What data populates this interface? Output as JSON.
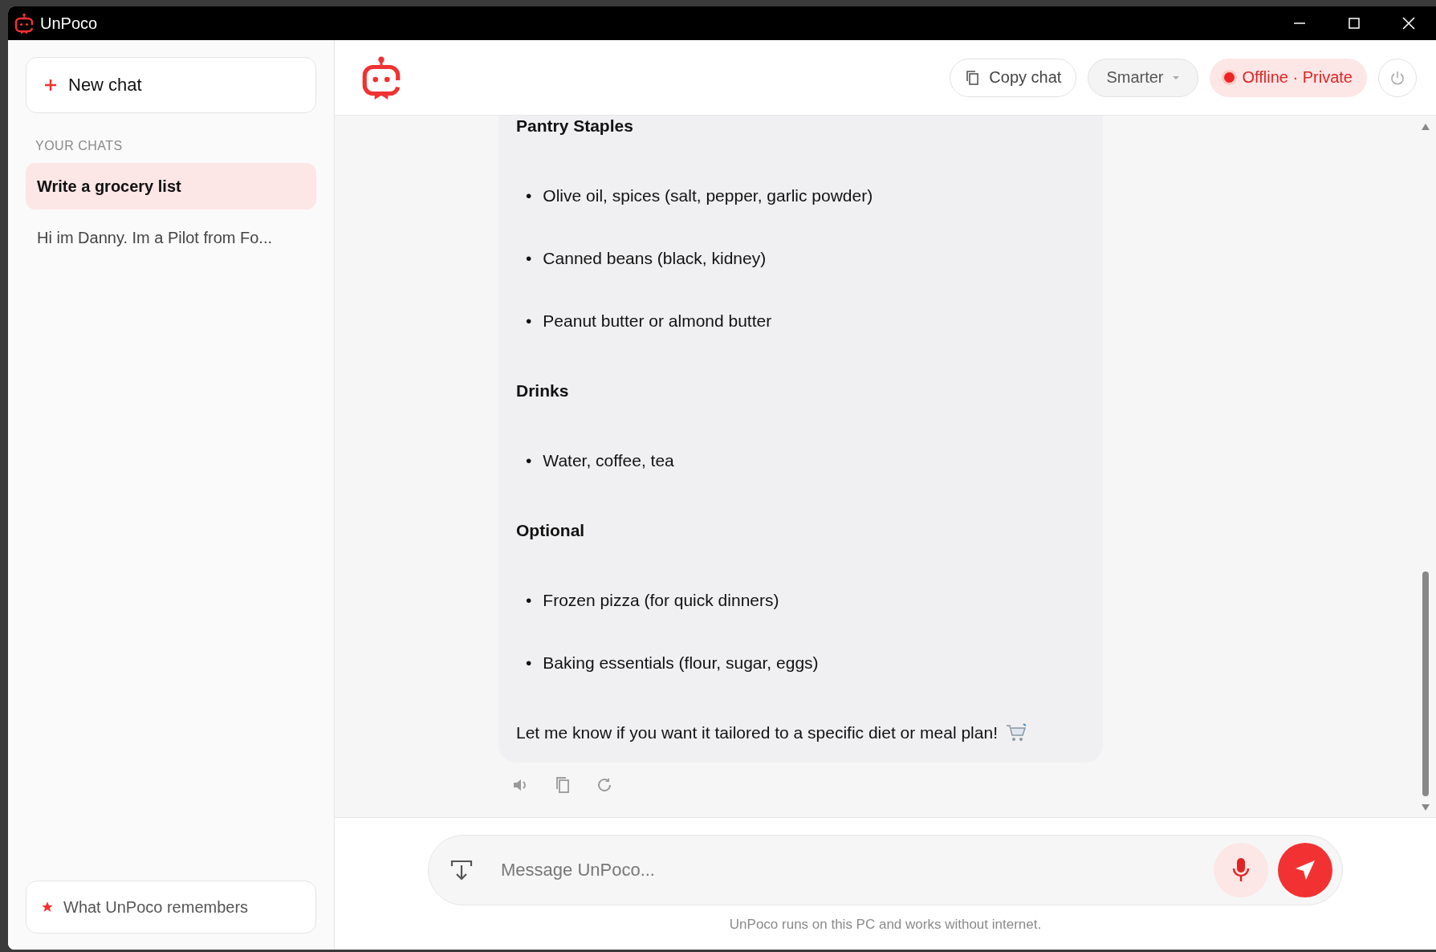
{
  "window": {
    "title": "UnPoco"
  },
  "sidebar": {
    "new_chat": "New chat",
    "section_label": "YOUR CHATS",
    "chats": [
      {
        "title": "Write a grocery list",
        "selected": true
      },
      {
        "title": "Hi im Danny. Im a Pilot from Fo...",
        "selected": false
      }
    ],
    "memory_button": "What UnPoco remembers"
  },
  "header": {
    "copy_chat": "Copy chat",
    "model": "Smarter",
    "status": "Offline · Private"
  },
  "message": {
    "sections": [
      {
        "heading": "Pantry Staples",
        "items": [
          {
            "bullet": "•",
            "text": "Olive oil, spices (salt, pepper, garlic powder)"
          },
          {
            "bullet": "•",
            "text": "Canned beans (black, kidney)"
          },
          {
            "bullet": "•",
            "text": "Peanut butter or almond butter"
          }
        ]
      },
      {
        "heading": "Drinks",
        "items": [
          {
            "bullet": "•",
            "text": "Water, coffee, tea"
          }
        ]
      },
      {
        "heading": "Optional",
        "items": [
          {
            "bullet": "•",
            "text": "Frozen pizza (for quick dinners)"
          },
          {
            "bullet": "•",
            "text": "Baking essentials (flour, sugar, eggs)"
          }
        ]
      }
    ],
    "closing": "Let me know if you want it tailored to a specific diet or meal plan!"
  },
  "composer": {
    "placeholder": "Message UnPoco...",
    "note": "UnPoco runs on this PC and works without internet."
  }
}
